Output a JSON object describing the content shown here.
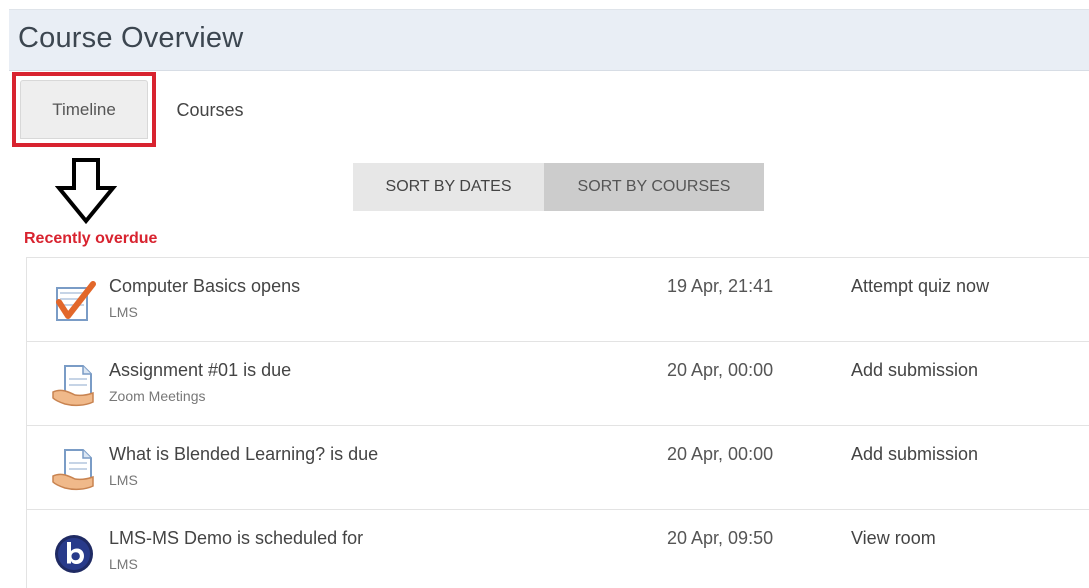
{
  "header": {
    "title": "Course Overview"
  },
  "tabs": [
    {
      "label": "Timeline",
      "active": true
    },
    {
      "label": "Courses",
      "active": false
    }
  ],
  "sort": {
    "by_dates": "SORT BY DATES",
    "by_courses": "SORT BY COURSES"
  },
  "section": {
    "label": "Recently overdue"
  },
  "colors": {
    "highlight": "#d8232f",
    "header_bg": "#e9eef5",
    "sort_active_bg": "#cccccc"
  },
  "items": [
    {
      "title": "Computer Basics opens",
      "course": "LMS",
      "date": "19 Apr, 21:41",
      "action": "Attempt quiz now",
      "icon": "quiz-icon"
    },
    {
      "title": "Assignment #01 is due",
      "course": "Zoom Meetings",
      "date": "20 Apr, 00:00",
      "action": "Add submission",
      "icon": "assignment-icon"
    },
    {
      "title": "What is Blended Learning? is due",
      "course": "LMS",
      "date": "20 Apr, 00:00",
      "action": "Add submission",
      "icon": "assignment-icon"
    },
    {
      "title": "LMS-MS Demo is scheduled for",
      "course": "LMS",
      "date": "20 Apr, 09:50",
      "action": "View room",
      "icon": "bigbluebutton-icon"
    }
  ]
}
